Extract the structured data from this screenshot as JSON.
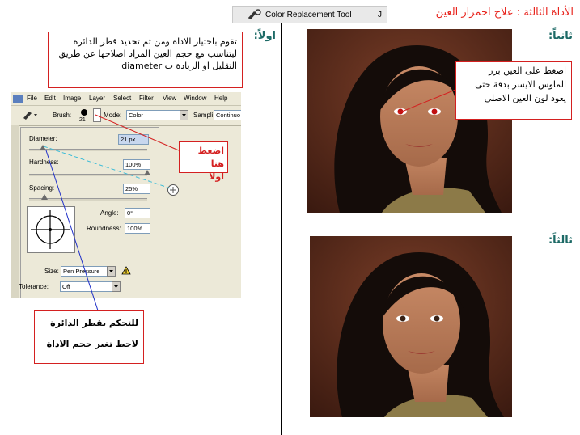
{
  "header": {
    "tool_button_label": "Color Replacement Tool",
    "tool_shortcut": "J",
    "title": "الأداة الثالثة : علاج احمرار العين"
  },
  "steps": {
    "first": "اولاً:",
    "second": "ثانياً:",
    "third": "ثالثاً:"
  },
  "callouts": {
    "intro": "تقوم باختيار الاداة ومن ثم تحديد قطر الدائرة ليتناسب مع حجم العين المراد اصلاحها عن طريق التقليل او الزيادة ب diameter",
    "click_here_line1": "اضغط هنا",
    "click_here_line2": "اولا",
    "circle_control_line1": "للتحكم بقطر الدائرة",
    "circle_control_line2": "لاحظ تغير حجم الاداة",
    "eye_click": "اضغط على العين بزر الماوس الايسر بدقة حتى يعود لون العين الاصلي"
  },
  "photoshop": {
    "menu": [
      "File",
      "Edit",
      "Image",
      "Layer",
      "Select",
      "Filter",
      "View",
      "Window",
      "Help"
    ],
    "brush_label": "Brush:",
    "brush_size": "21",
    "mode_label": "Mode:",
    "mode_value": "Color",
    "sampling_label": "Sampling:",
    "sampling_value": "Continuo",
    "diameter_label": "Diameter:",
    "diameter_value": "21 px",
    "hardness_label": "Hardness:",
    "hardness_value": "100%",
    "spacing_label": "Spacing:",
    "spacing_value": "25%",
    "angle_label": "Angle:",
    "angle_value": "0°",
    "roundness_label": "Roundness:",
    "roundness_value": "100%",
    "size_label": "Size:",
    "size_value": "Pen Pressure",
    "tolerance_label": "Tolerance:",
    "tolerance_value": "Off"
  },
  "colors": {
    "accent_red": "#e8241d",
    "step_teal": "#1d6a66",
    "callout_border": "#d42020"
  }
}
